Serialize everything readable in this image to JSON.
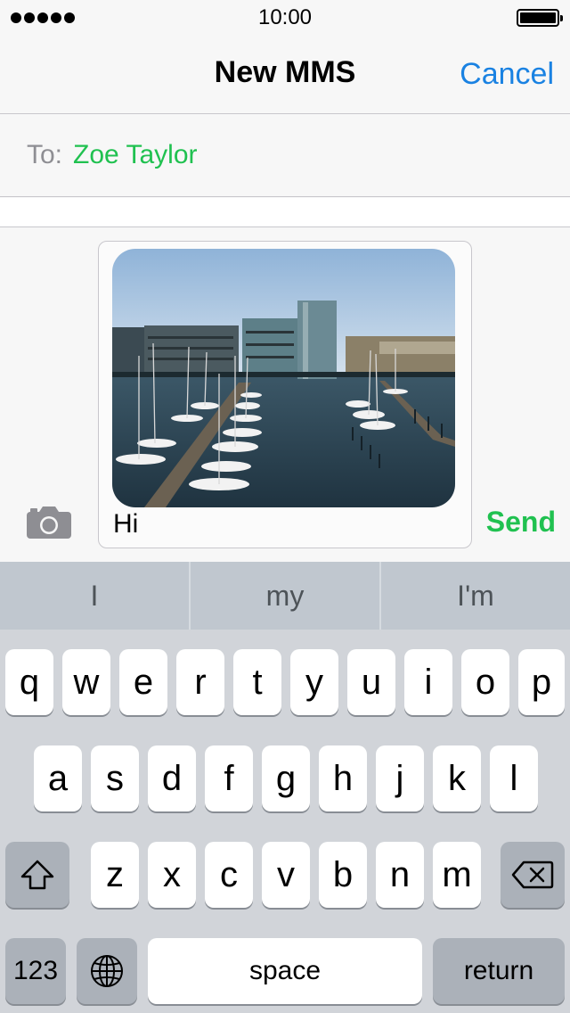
{
  "status_bar": {
    "time": "10:00",
    "signal_icon": "signal-dots-icon",
    "battery_icon": "battery-icon"
  },
  "nav": {
    "title": "New MMS",
    "cancel_label": "Cancel"
  },
  "to_field": {
    "label": "To:",
    "recipient": "Zoe Taylor"
  },
  "compose": {
    "camera_icon": "camera-icon",
    "text": "Hi",
    "send_label": "Send",
    "attachment": "marina-photo"
  },
  "suggestions": [
    "I",
    "my",
    "I'm"
  ],
  "keyboard": {
    "row1": [
      "q",
      "w",
      "e",
      "r",
      "t",
      "y",
      "u",
      "i",
      "o",
      "p"
    ],
    "row2": [
      "a",
      "s",
      "d",
      "f",
      "g",
      "h",
      "j",
      "k",
      "l"
    ],
    "row3": [
      "z",
      "x",
      "c",
      "v",
      "b",
      "n",
      "m"
    ],
    "shift_icon": "shift-icon",
    "delete_icon": "delete-icon",
    "globe_icon": "globe-icon",
    "numbers_label": "123",
    "space_label": "space",
    "return_label": "return"
  },
  "colors": {
    "accent_blue": "#1a82e2",
    "accent_green": "#20c150",
    "keyboard_bg": "#d1d4d9",
    "suggest_bg": "#c0c7cf"
  }
}
